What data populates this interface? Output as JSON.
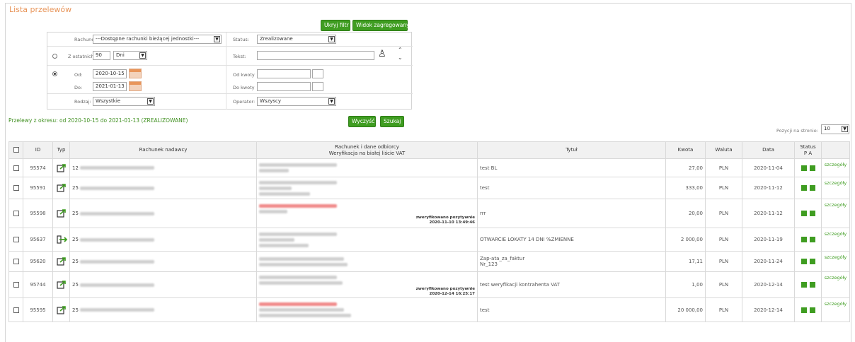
{
  "page": {
    "title": "Lista przelewów"
  },
  "toolbar": {
    "hide_filter": "Ukryj filtr",
    "aggregated_view": "Widok zagregowany"
  },
  "filter": {
    "account_label": "Rachunek:",
    "account_value": "---Dostępne rachunki bieżącej jednostki---",
    "status_label": "Status:",
    "status_value": "Zrealizowane",
    "last_label": "Z ostatnich:",
    "last_value": "90",
    "last_unit": "Dni",
    "text_label": "Tekst:",
    "text_value": "",
    "from_label": "Od:",
    "from_value": "2020-10-15",
    "to_label": "Do:",
    "to_value": "2021-01-13",
    "amount_from_label": "Od kwoty",
    "amount_to_label": "Do kwoty",
    "kind_label": "Rodzaj:",
    "kind_value": "Wszystkie",
    "operator_label": "Operator:",
    "operator_value": "Wszyscy",
    "clear_button": "Wyczyść",
    "search_button": "Szukaj"
  },
  "period_text": "Przelewy z okresu: od 2020-10-15 do 2021-01-13 (ZREALIZOWANE)",
  "per_page": {
    "label": "Pozycji na stronie:",
    "value": "10"
  },
  "table": {
    "headers": {
      "id": "ID",
      "type": "Typ",
      "sender": "Rachunek nadawcy",
      "recipient_1": "Rachunek i dane odbiorcy",
      "recipient_2": "Weryfikacja na białej liście VAT",
      "title": "Tytuł",
      "amount": "Kwota",
      "currency": "Waluta",
      "date": "Data",
      "status_1": "Status",
      "status_2": "P A"
    },
    "rows": [
      {
        "id": "95574",
        "type_icon": "outgoing-transfer-icon",
        "sender_prefix": "12",
        "title_1": "test BL",
        "title_2": "",
        "verified": "",
        "verified_date": "",
        "amount": "27,00",
        "currency": "PLN",
        "date": "2020-11-04",
        "details": "szczegóły"
      },
      {
        "id": "95591",
        "type_icon": "outgoing-transfer-icon",
        "sender_prefix": "25",
        "title_1": "test",
        "title_2": "",
        "verified": "",
        "verified_date": "",
        "amount": "333,00",
        "currency": "PLN",
        "date": "2020-11-12",
        "details": "szczegóły"
      },
      {
        "id": "95598",
        "type_icon": "outgoing-transfer-icon",
        "sender_prefix": "25",
        "title_1": "rrr",
        "title_2": "",
        "verified": "zweryfikowano pozytywnie",
        "verified_date": "2020-11-10 13:49:46",
        "amount": "20,00",
        "currency": "PLN",
        "date": "2020-11-12",
        "details": "szczegóły"
      },
      {
        "id": "95637",
        "type_icon": "deposit-transfer-icon",
        "sender_prefix": "25",
        "title_1": "OTWARCIE LOKATY 14 DNI %ZMIENNE",
        "title_2": "",
        "verified": "",
        "verified_date": "",
        "amount": "2 000,00",
        "currency": "PLN",
        "date": "2020-11-19",
        "details": "szczegóły"
      },
      {
        "id": "95620",
        "type_icon": "outgoing-transfer-icon",
        "sender_prefix": "25",
        "title_1": "Zap-ata_za_faktur",
        "title_2": "Nr_123",
        "verified": "",
        "verified_date": "",
        "amount": "17,11",
        "currency": "PLN",
        "date": "2020-11-24",
        "details": "szczegóły"
      },
      {
        "id": "95744",
        "type_icon": "outgoing-transfer-icon",
        "sender_prefix": "25",
        "title_1": "test weryfikacji kontrahenta VAT",
        "title_2": "",
        "verified": "zweryfikowano pozytywnie",
        "verified_date": "2020-12-14 16:25:17",
        "amount": "1,00",
        "currency": "PLN",
        "date": "2020-12-14",
        "details": "szczegóły"
      },
      {
        "id": "95595",
        "type_icon": "outgoing-transfer-icon",
        "sender_prefix": "25",
        "title_1": "test",
        "title_2": "",
        "verified": "",
        "verified_date": "",
        "amount": "20 000,00",
        "currency": "PLN",
        "date": "2020-12-14",
        "details": "szczegóły"
      }
    ]
  },
  "colors": {
    "accent_green": "#3f9d21",
    "title_orange": "#e8955a",
    "blur_red": "#f08a8a"
  }
}
